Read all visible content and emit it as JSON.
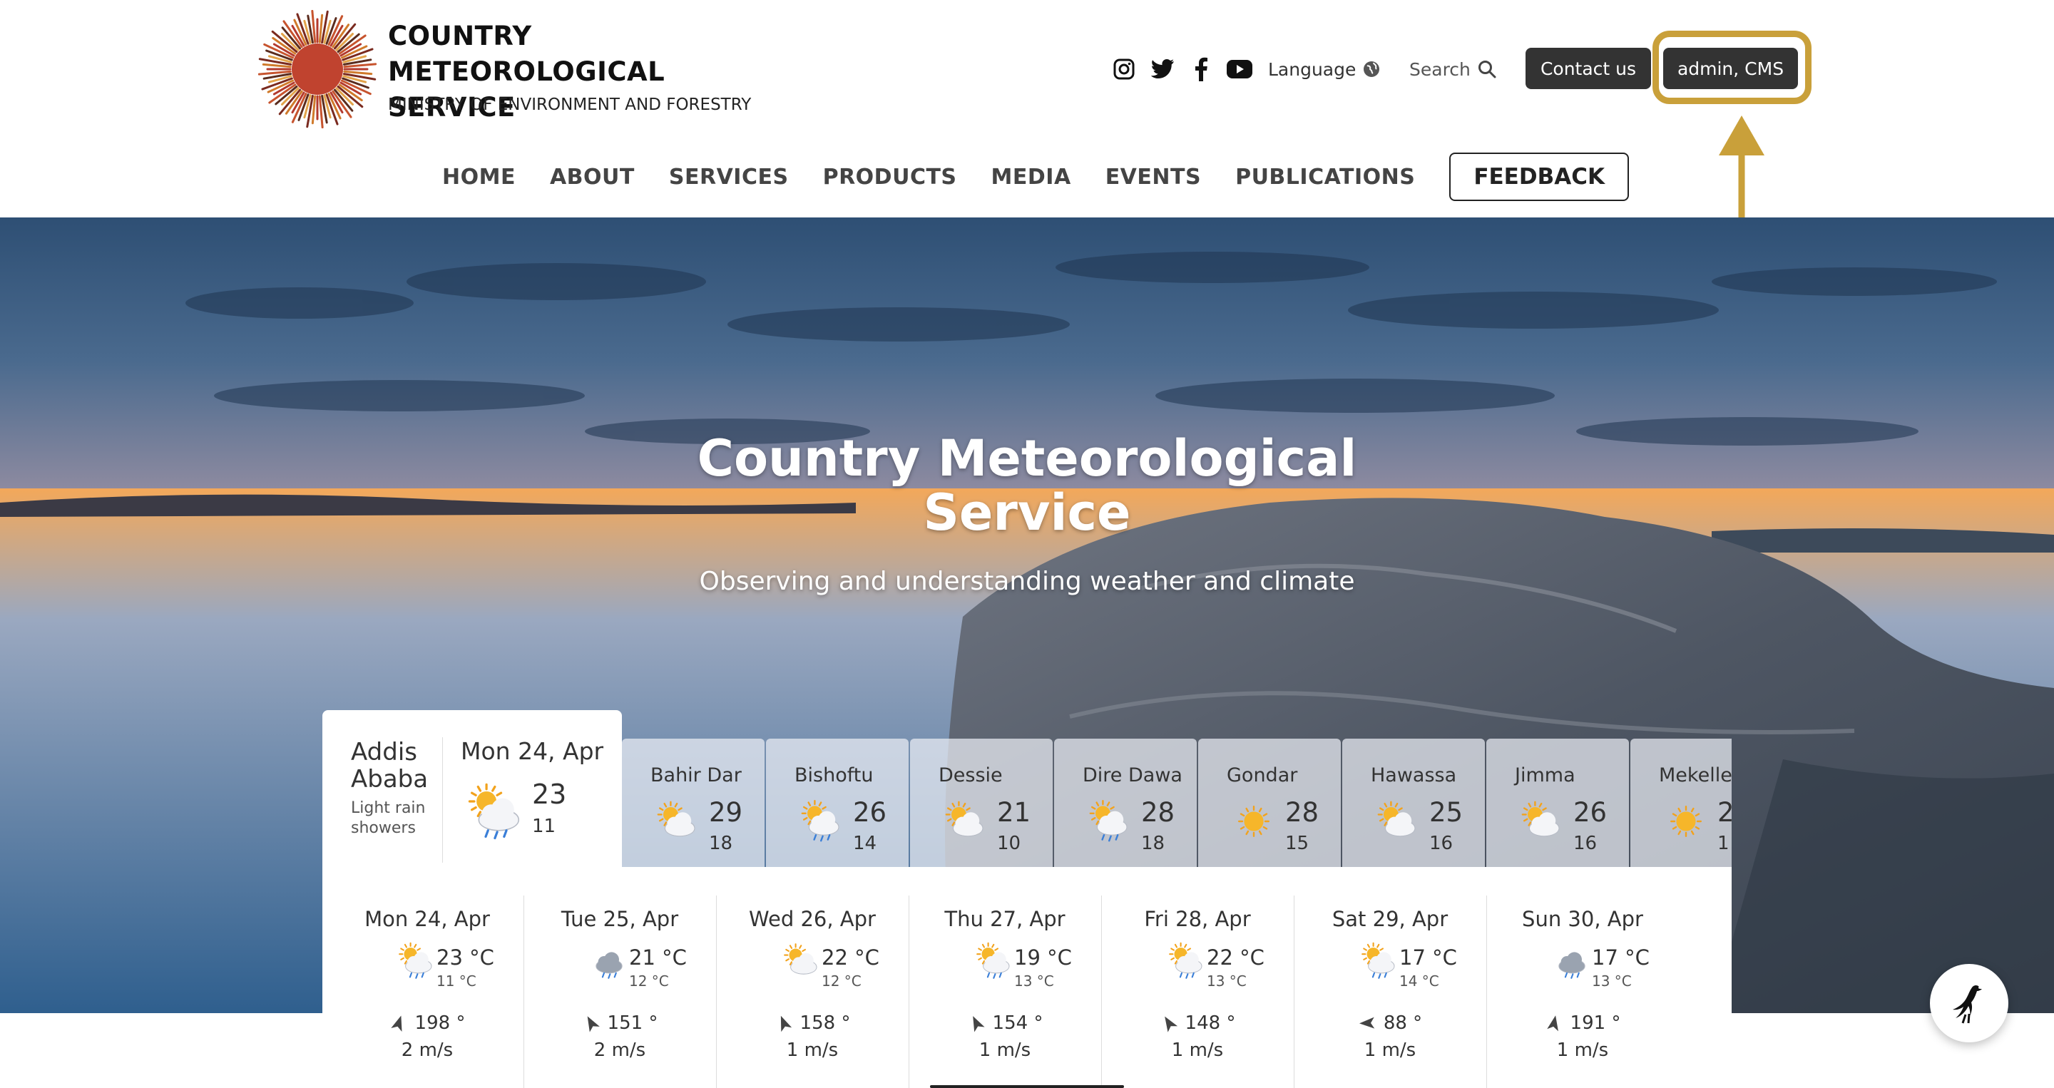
{
  "header": {
    "title": "COUNTRY METEOROLOGICAL SERVICE",
    "subtitle": "MINISTRY OF ENVIRONMENT AND FORESTRY",
    "social_icons": [
      "instagram-icon",
      "twitter-icon",
      "facebook-icon",
      "youtube-icon"
    ],
    "language_label": "Language",
    "search_label": "Search",
    "contact_label": "Contact us",
    "admin_label": "admin, CMS",
    "highlight_color": "#c9a03a"
  },
  "nav": {
    "items": [
      "HOME",
      "ABOUT",
      "SERVICES",
      "PRODUCTS",
      "MEDIA",
      "EVENTS",
      "PUBLICATIONS"
    ],
    "feedback_label": "FEEDBACK"
  },
  "hero": {
    "title": "Country Meteorological Service",
    "subtitle": "Observing and understanding weather and climate"
  },
  "current": {
    "city": "Addis Ababa",
    "description": "Light rain showers",
    "date": "Mon 24, Apr",
    "icon": "sun-cloud-rain-icon",
    "max": "23",
    "min": "11"
  },
  "cities": [
    {
      "name": "Bahir Dar",
      "max": "29",
      "min": "18",
      "icon": "sun-cloud-icon"
    },
    {
      "name": "Bishoftu",
      "max": "26",
      "min": "14",
      "icon": "sun-cloud-rain-icon"
    },
    {
      "name": "Dessie",
      "max": "21",
      "min": "10",
      "icon": "sun-cloud-icon"
    },
    {
      "name": "Dire Dawa",
      "max": "28",
      "min": "18",
      "icon": "sun-cloud-rain-icon"
    },
    {
      "name": "Gondar",
      "max": "28",
      "min": "15",
      "icon": "sun-icon"
    },
    {
      "name": "Hawassa",
      "max": "25",
      "min": "16",
      "icon": "sun-cloud-icon"
    },
    {
      "name": "Jimma",
      "max": "26",
      "min": "16",
      "icon": "sun-cloud-icon"
    },
    {
      "name": "Mekelle",
      "max": "2",
      "min": "1",
      "icon": "sun-icon"
    }
  ],
  "week": [
    {
      "day": "Mon 24, Apr",
      "max": "23 °C",
      "min": "11 °C",
      "dir": "198 °",
      "speed": "2 m/s",
      "icon": "sun-cloud-rain-icon",
      "angle": 198
    },
    {
      "day": "Tue 25, Apr",
      "max": "21 °C",
      "min": "12 °C",
      "dir": "151 °",
      "speed": "2 m/s",
      "icon": "cloud-rain-icon",
      "angle": 151
    },
    {
      "day": "Wed 26, Apr",
      "max": "22 °C",
      "min": "12 °C",
      "dir": "158 °",
      "speed": "1 m/s",
      "icon": "sun-cloud-icon",
      "angle": 158
    },
    {
      "day": "Thu 27, Apr",
      "max": "19 °C",
      "min": "13 °C",
      "dir": "154 °",
      "speed": "1 m/s",
      "icon": "sun-cloud-rain-icon",
      "angle": 154
    },
    {
      "day": "Fri 28, Apr",
      "max": "22 °C",
      "min": "13 °C",
      "dir": "148 °",
      "speed": "1 m/s",
      "icon": "sun-cloud-rain-icon",
      "angle": 148
    },
    {
      "day": "Sat 29, Apr",
      "max": "17 °C",
      "min": "14 °C",
      "dir": "88 °",
      "speed": "1 m/s",
      "icon": "sun-cloud-rain-icon",
      "angle": 88
    },
    {
      "day": "Sun 30, Apr",
      "max": "17 °C",
      "min": "13 °C",
      "dir": "191 °",
      "speed": "1 m/s",
      "icon": "cloud-rain-icon",
      "angle": 191
    }
  ],
  "chat_icon": "bird-icon"
}
